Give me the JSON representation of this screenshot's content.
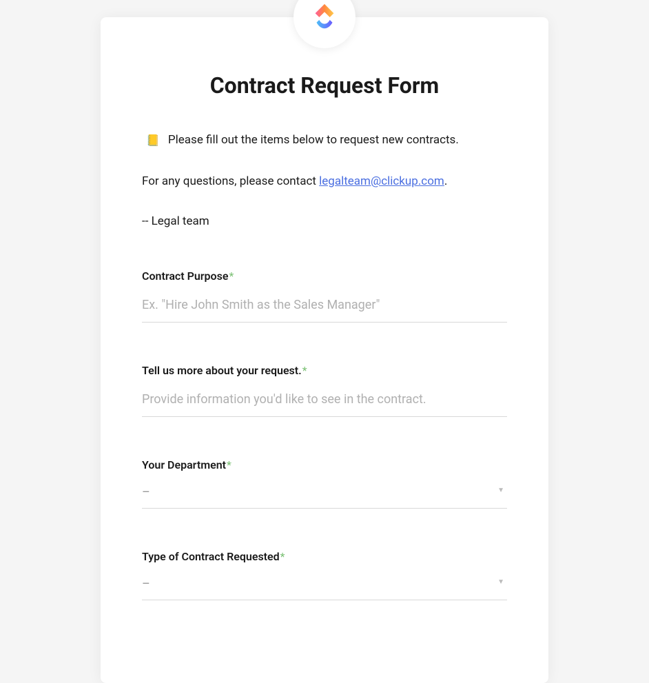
{
  "form": {
    "title": "Contract Request Form",
    "intro": {
      "line1": "Please fill out the items below to request new contracts.",
      "line2_prefix": "For any questions, please contact ",
      "email": "legalteam@clickup.com",
      "line2_suffix": ".",
      "signature": "-- Legal team"
    },
    "fields": {
      "contract_purpose": {
        "label": "Contract Purpose",
        "placeholder": "Ex. \"Hire John Smith as the Sales Manager\""
      },
      "tell_us_more": {
        "label": "Tell us more about your request.",
        "placeholder": "Provide information you'd like to see in the contract."
      },
      "department": {
        "label": "Your Department",
        "value": "–"
      },
      "contract_type": {
        "label": "Type of Contract Requested",
        "value": "–"
      }
    },
    "required_marker": "*"
  }
}
